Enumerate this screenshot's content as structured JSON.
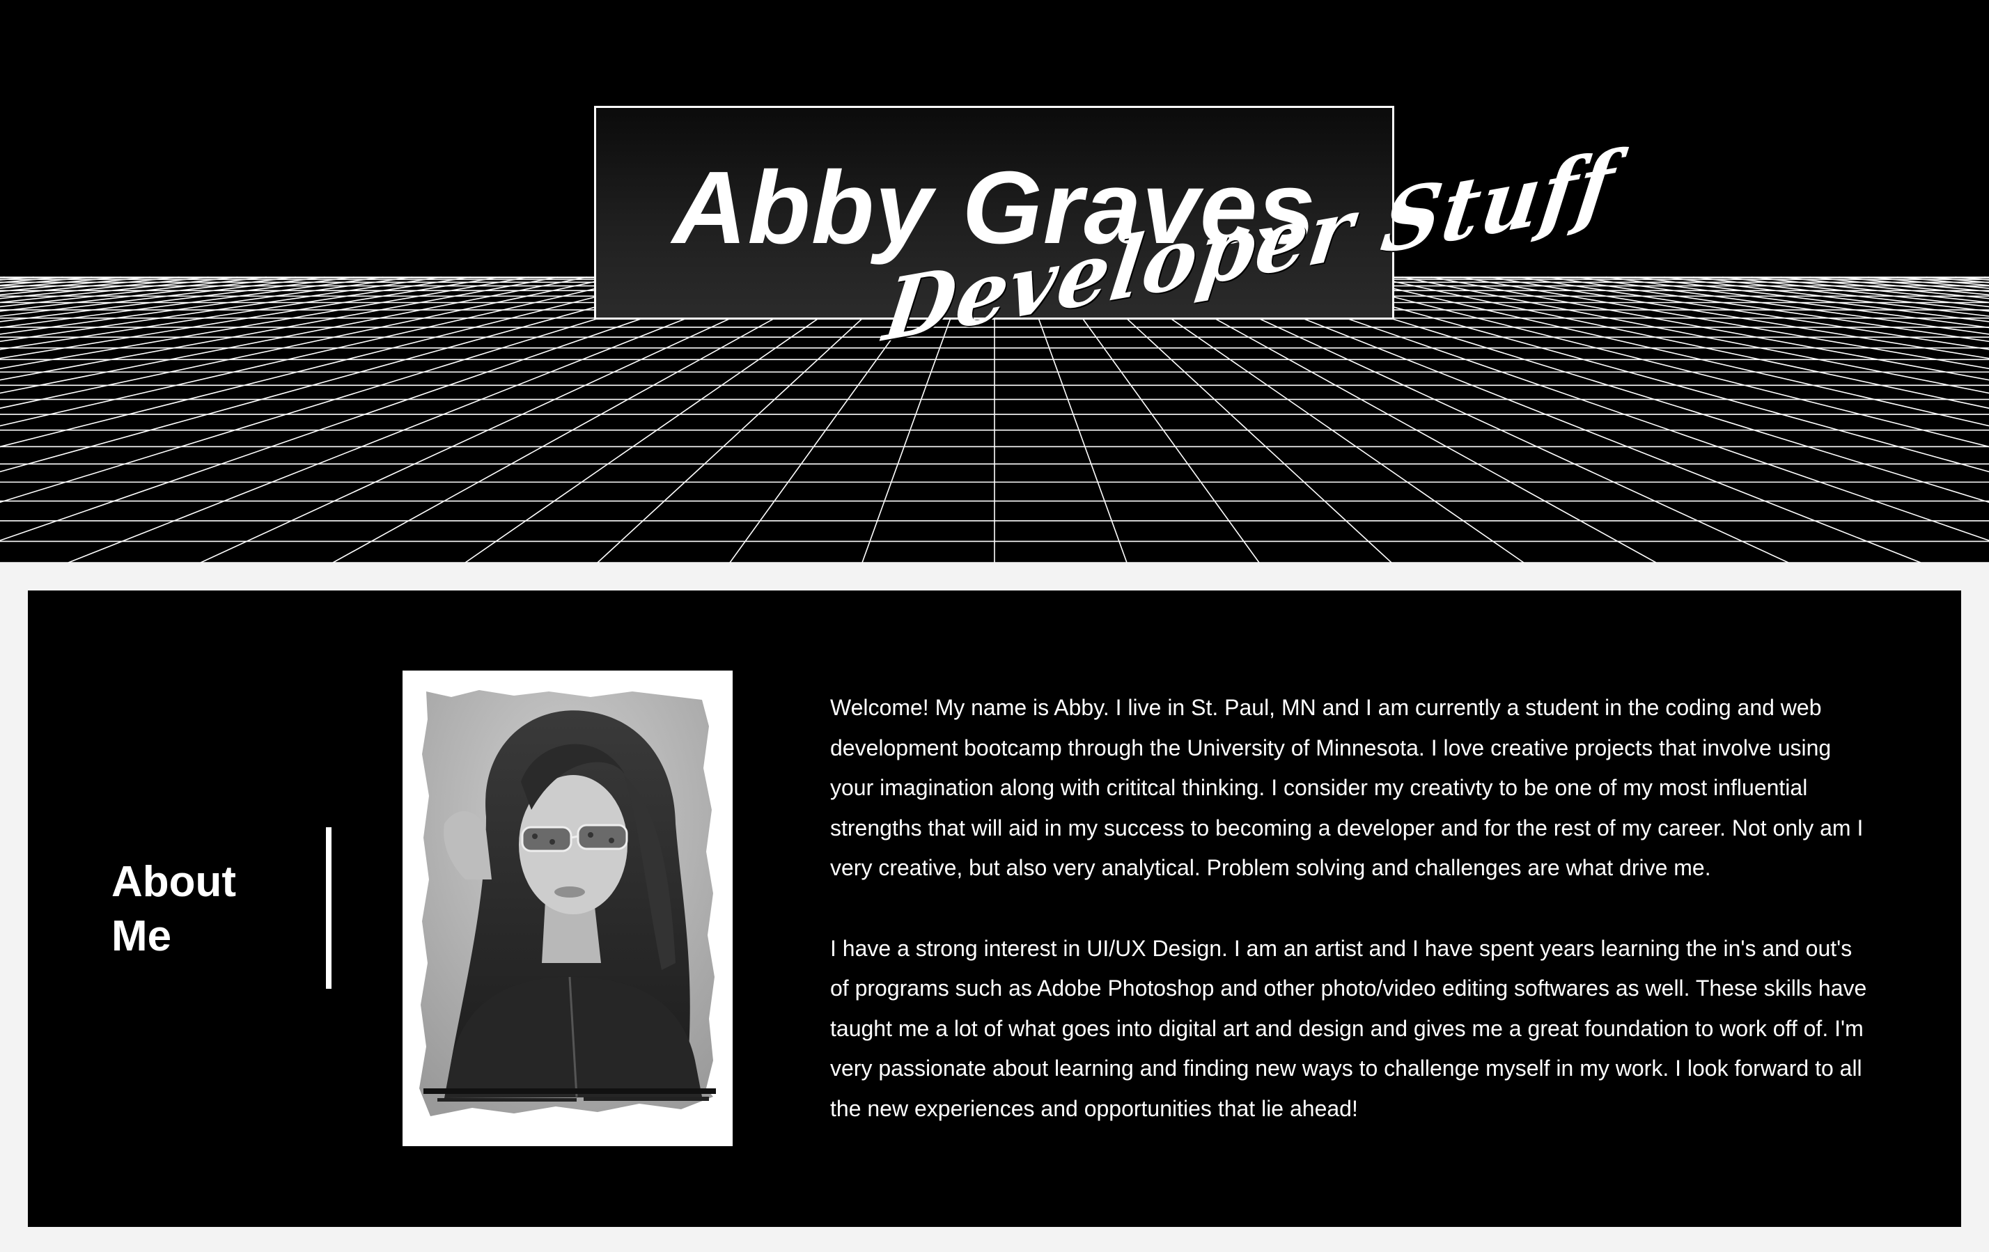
{
  "hero": {
    "name": "Abby Graves",
    "subtitle": "Developer Stuff"
  },
  "about": {
    "heading_line1": "About",
    "heading_line2": "Me",
    "paragraphs": [
      "Welcome! My name is Abby. I live in St. Paul, MN and I am currently a student in the coding and web development bootcamp through the University of Minnesota. I love creative projects that involve using your imagination along with crititcal thinking. I consider my creativty to be one of my most influential strengths that will aid in my success to becoming a developer and for the rest of my career. Not only am I very creative, but also very analytical. Problem solving and challenges are what drive me.",
      "I have a strong interest in UI/UX Design. I am an artist and I have spent years learning the in's and out's of programs such as Adobe Photoshop and other photo/video editing softwares as well. These skills have taught me a lot of what goes into digital art and design and gives me a great foundation to work off of. I'm very passionate about learning and finding new ways to challenge myself in my work. I look forward to all the new experiences and opportunities that lie ahead!"
    ]
  },
  "colors": {
    "hero_background": "#000000",
    "grid_lines": "#ffffff",
    "page_background": "#f3f3f3",
    "section_background": "#000000",
    "text": "#ffffff"
  }
}
